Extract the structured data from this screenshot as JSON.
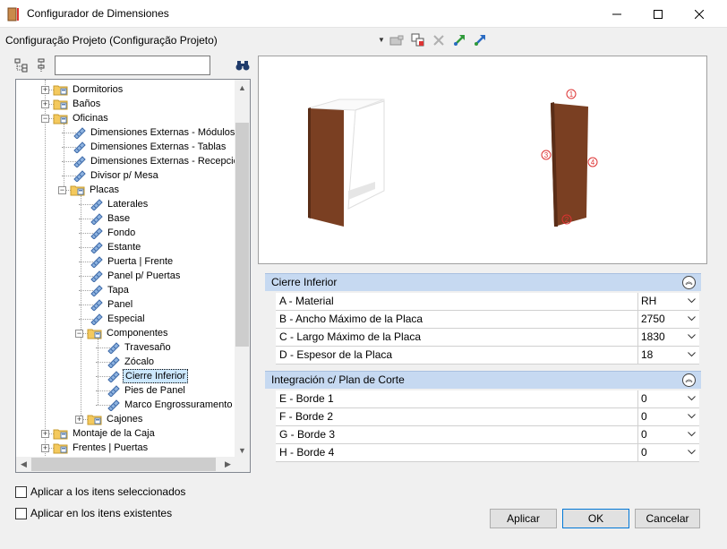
{
  "window": {
    "title": "Configurador de Dimensiones"
  },
  "toolbar": {
    "configuration": "Configuração Projeto (Configuração Projeto)"
  },
  "tree": {
    "search_value": "",
    "items": [
      {
        "label": "Dormitorios"
      },
      {
        "label": "Baños"
      },
      {
        "label": "Oficinas"
      },
      {
        "label": "Dimensiones Externas - Módulos"
      },
      {
        "label": "Dimensiones Externas - Tablas"
      },
      {
        "label": "Dimensiones Externas - Recepción"
      },
      {
        "label": "Divisor p/ Mesa"
      },
      {
        "label": "Placas"
      },
      {
        "label": "Laterales"
      },
      {
        "label": "Base"
      },
      {
        "label": "Fondo"
      },
      {
        "label": "Estante"
      },
      {
        "label": "Puerta | Frente"
      },
      {
        "label": "Panel p/ Puertas"
      },
      {
        "label": "Tapa"
      },
      {
        "label": "Panel"
      },
      {
        "label": "Especial"
      },
      {
        "label": "Componentes"
      },
      {
        "label": "Travesaño"
      },
      {
        "label": "Zócalo"
      },
      {
        "label": "Cierre Inferior"
      },
      {
        "label": "Pies de Panel"
      },
      {
        "label": "Marco Engrossuramento"
      },
      {
        "label": "Cajones"
      },
      {
        "label": "Montaje de la Caja"
      },
      {
        "label": "Frentes | Puertas"
      }
    ]
  },
  "preview": {
    "markers": [
      "1",
      "2",
      "3",
      "4"
    ]
  },
  "groups": [
    {
      "title": "Cierre Inferior",
      "props": [
        {
          "label": "A - Material",
          "value": "RH"
        },
        {
          "label": "B -  Ancho Máximo de la Placa",
          "value": "2750"
        },
        {
          "label": "C - Largo Máximo de la Placa",
          "value": "1830"
        },
        {
          "label": "D - Espesor de la Placa",
          "value": "18"
        }
      ]
    },
    {
      "title": "Integración c/ Plan de Corte",
      "props": [
        {
          "label": "E - Borde 1",
          "value": "0"
        },
        {
          "label": "F - Borde 2",
          "value": "0"
        },
        {
          "label": "G - Borde 3",
          "value": "0"
        },
        {
          "label": "H - Borde 4",
          "value": "0"
        }
      ]
    }
  ],
  "options": {
    "apply_selected": "Aplicar a los itens seleccionados",
    "apply_existing": "Aplicar en los itens existentes"
  },
  "buttons": {
    "apply": "Aplicar",
    "ok": "OK",
    "cancel": "Cancelar"
  },
  "colors": {
    "wood": "#7a3f22",
    "group_header": "#c6d9f1",
    "selection": "#cce8ff"
  }
}
